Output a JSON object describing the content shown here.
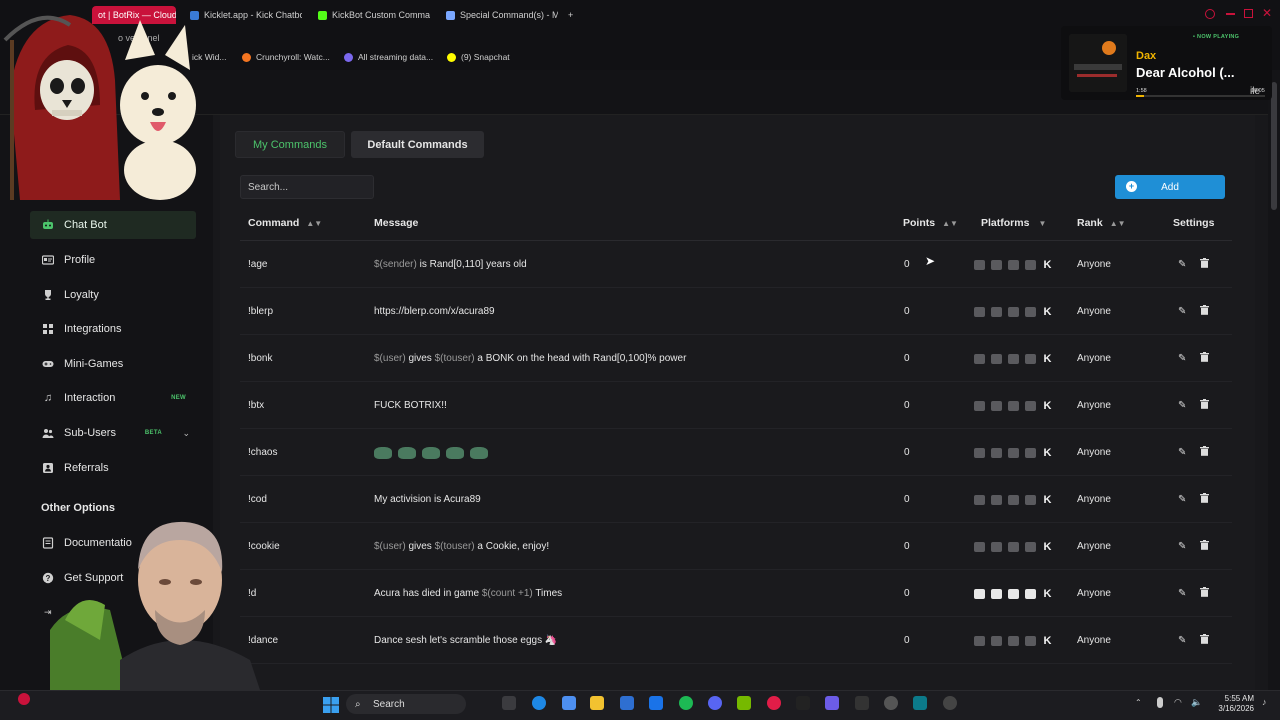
{
  "browser": {
    "tabs": [
      {
        "label": "ot | BotRix — Cloud",
        "active": true
      },
      {
        "label": "Kicklet.app - Kick Chatbot",
        "active": false
      },
      {
        "label": "KickBot Custom Command",
        "active": false
      },
      {
        "label": "Special Command(s) - Ma",
        "active": false
      }
    ],
    "new_tab": "+",
    "address_fragment": "o  ve/panel",
    "bookmarks": [
      "ick Wid...",
      "Crunchyroll: Watc...",
      "All streaming data...",
      "(9) Snapchat"
    ]
  },
  "now_playing": {
    "tag": "• NOW PLAYING",
    "artist": "Dax",
    "title": "Dear Alcohol (...",
    "time_elapsed": "1:58",
    "time_total": "10:05",
    "progress": 0.06,
    "edge_text": "ile"
  },
  "sidebar": {
    "items": [
      {
        "label": "Chat Bot",
        "icon": "robot-icon",
        "active": true
      },
      {
        "label": "Profile",
        "icon": "id-card-icon"
      },
      {
        "label": "Loyalty",
        "icon": "trophy-icon"
      },
      {
        "label": "Integrations",
        "icon": "grid-icon"
      },
      {
        "label": "Mini-Games",
        "icon": "gamepad-icon"
      },
      {
        "label": "Interaction",
        "icon": "music-note-icon",
        "badge": "NEW"
      },
      {
        "label": "Sub-Users",
        "icon": "users-icon",
        "badge": "BETA",
        "expandable": true
      },
      {
        "label": "Referrals",
        "icon": "people-icon"
      }
    ],
    "other_options_title": "Other Options",
    "other_items": [
      {
        "label": "Documentatio",
        "icon": "book-icon"
      },
      {
        "label": "Get Support",
        "icon": "question-icon"
      }
    ]
  },
  "tabs": {
    "my_commands": "My Commands",
    "default_commands": "Default Commands"
  },
  "search": {
    "placeholder": "Search..."
  },
  "add_button": "Add",
  "table": {
    "headers": {
      "command": "Command",
      "message": "Message",
      "points": "Points",
      "platforms": "Platforms",
      "rank": "Rank",
      "settings": "Settings"
    },
    "rows": [
      {
        "command": "!age",
        "message": [
          {
            "t": "$(sender)",
            "v": true
          },
          {
            "t": " is Rand[0,110] years old"
          }
        ],
        "points": "0",
        "rank": "Anyone",
        "all_platforms": false
      },
      {
        "command": "!blerp",
        "message": [
          {
            "t": "https://blerp.com/x/acura89"
          }
        ],
        "points": "0",
        "rank": "Anyone",
        "all_platforms": false
      },
      {
        "command": "!bonk",
        "message": [
          {
            "t": "$(user)",
            "v": true
          },
          {
            "t": " gives "
          },
          {
            "t": "$(touser)",
            "v": true
          },
          {
            "t": " a BONK on the head with Rand[0,100]% power"
          }
        ],
        "points": "0",
        "rank": "Anyone",
        "all_platforms": false
      },
      {
        "command": "!btx",
        "message": [
          {
            "t": "FUCK BOTRIX!!"
          }
        ],
        "points": "0",
        "rank": "Anyone",
        "all_platforms": false
      },
      {
        "command": "!chaos",
        "message": [],
        "emotes": 5,
        "points": "0",
        "rank": "Anyone",
        "all_platforms": false
      },
      {
        "command": "!cod",
        "message": [
          {
            "t": "My activision is Acura89"
          }
        ],
        "points": "0",
        "rank": "Anyone",
        "all_platforms": false
      },
      {
        "command": "!cookie",
        "message": [
          {
            "t": "$(user)",
            "v": true
          },
          {
            "t": " gives "
          },
          {
            "t": "$(touser)",
            "v": true
          },
          {
            "t": " a Cookie, enjoy!"
          }
        ],
        "points": "0",
        "rank": "Anyone",
        "all_platforms": false
      },
      {
        "command": "!d",
        "message": [
          {
            "t": "Acura has died in game "
          },
          {
            "t": "$(count +1)",
            "v": true
          },
          {
            "t": " Times"
          }
        ],
        "points": "0",
        "rank": "Anyone",
        "all_platforms": true
      },
      {
        "command": "!dance",
        "message": [
          {
            "t": "Dance sesh let's scramble those eggs 🦄"
          }
        ],
        "points": "0",
        "rank": "Anyone",
        "all_platforms": false
      }
    ]
  },
  "taskbar": {
    "search_label": "Search",
    "time": "5:55 AM",
    "date": "3/16/2026"
  }
}
